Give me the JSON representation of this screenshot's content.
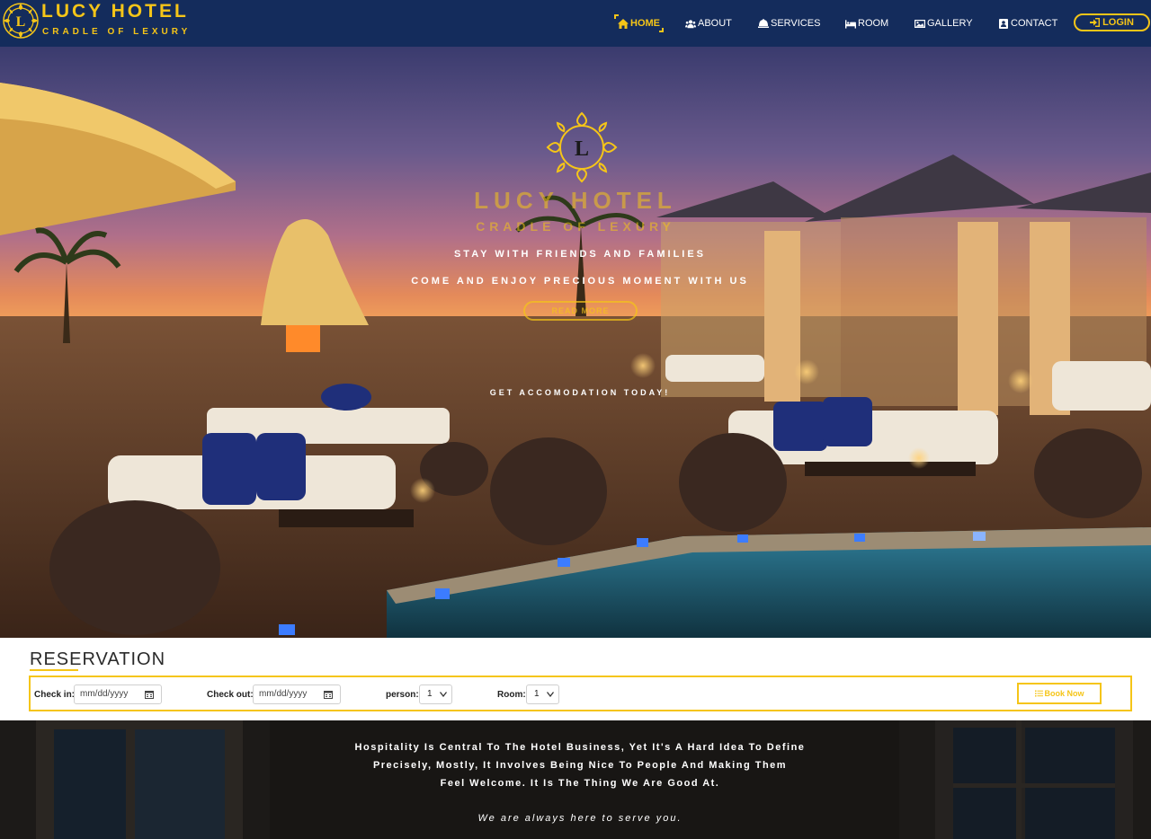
{
  "brand": {
    "logo_letter": "L",
    "name": "LUCY HOTEL",
    "tagline": "CRADLE OF LEXURY"
  },
  "nav": {
    "items": [
      {
        "label": "HOME",
        "icon": "home-icon",
        "active": true
      },
      {
        "label": "ABOUT",
        "icon": "users-icon",
        "active": false
      },
      {
        "label": "SERVICES",
        "icon": "bell-icon",
        "active": false
      },
      {
        "label": "ROOM",
        "icon": "bed-icon",
        "active": false
      },
      {
        "label": "GALLERY",
        "icon": "image-icon",
        "active": false
      },
      {
        "label": "CONTACT",
        "icon": "contact-icon",
        "active": false
      }
    ],
    "login_label": "LOGIN"
  },
  "hero": {
    "emblem_letter": "L",
    "title": "LUCY HOTEL",
    "tagline": "CRADLE OF LEXURY",
    "line1": "STAY WITH FRIENDS AND FAMILIES",
    "line2": "COME AND ENJOY PRECIOUS MOMENT WITH US",
    "read_more": "READ MORE",
    "line3": "GET ACCOMODATION TODAY!"
  },
  "reservation": {
    "title": "RESERVATION",
    "checkin_label": "Check in:",
    "checkin_placeholder": "mm/dd/yyyy",
    "checkout_label": "Check out:",
    "checkout_placeholder": "mm/dd/yyyy",
    "person_label": "person:",
    "person_value": "1",
    "room_label": "Room:",
    "room_value": "1",
    "book_label": "Book Now"
  },
  "about": {
    "line1": "Hospitality Is Central To The Hotel Business, Yet It's A Hard Idea To Define",
    "line2": "Precisely, Mostly, It Involves Being Nice To People And Making Them",
    "line3": "Feel Welcome. It Is The Thing We Are Good At.",
    "quote": "We are always here to serve you."
  },
  "colors": {
    "navbar": "#142c5c",
    "accent": "#f5c518",
    "white": "#ffffff"
  }
}
